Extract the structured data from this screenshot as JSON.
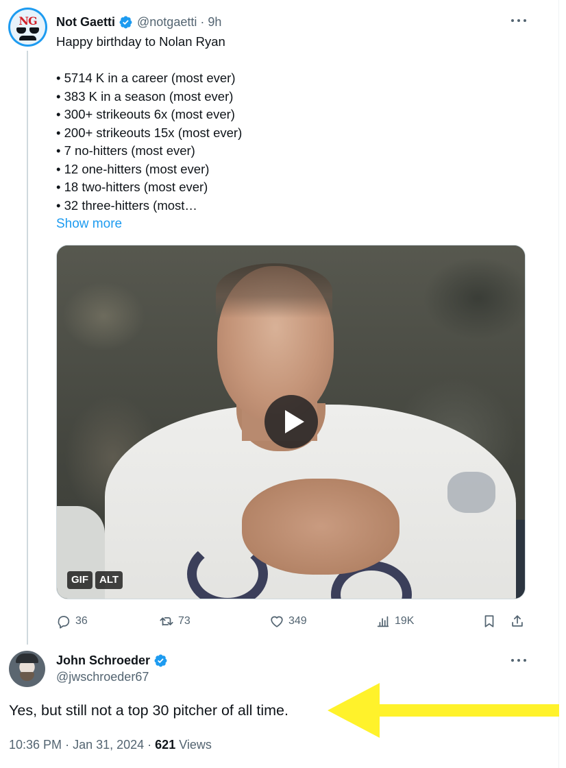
{
  "colors": {
    "accent": "#1d9bf0",
    "muted": "#536471",
    "text": "#0f1419",
    "arrow": "#fff22b"
  },
  "tweet": {
    "author_name": "Not Gaetti",
    "author_handle": "@notgaetti",
    "time": "9h",
    "avatar_text": "NG",
    "text": "Happy birthday to Nolan Ryan\n\n• 5714 K in a career (most ever)\n• 383 K in a season (most ever)\n• 300+ strikeouts 6x (most ever)\n• 200+ strikeouts 15x (most ever)\n• 7 no-hitters (most ever)\n• 12 one-hitters (most ever)\n• 18 two-hitters (most ever)\n• 32 three-hitters (most…",
    "show_more": "Show more",
    "media": {
      "gif_badge": "GIF",
      "alt_badge": "ALT",
      "play_icon": "play-icon"
    },
    "actions": {
      "replies": "36",
      "reposts": "73",
      "likes": "349",
      "views": "19K"
    }
  },
  "reply": {
    "author_name": "John Schroeder",
    "author_handle": "@jwschroeder67",
    "text": "Yes, but still not a top 30 pitcher of all time.",
    "time": "10:36 PM",
    "date": "Jan 31, 2024",
    "views_count": "621",
    "views_label": "Views"
  }
}
